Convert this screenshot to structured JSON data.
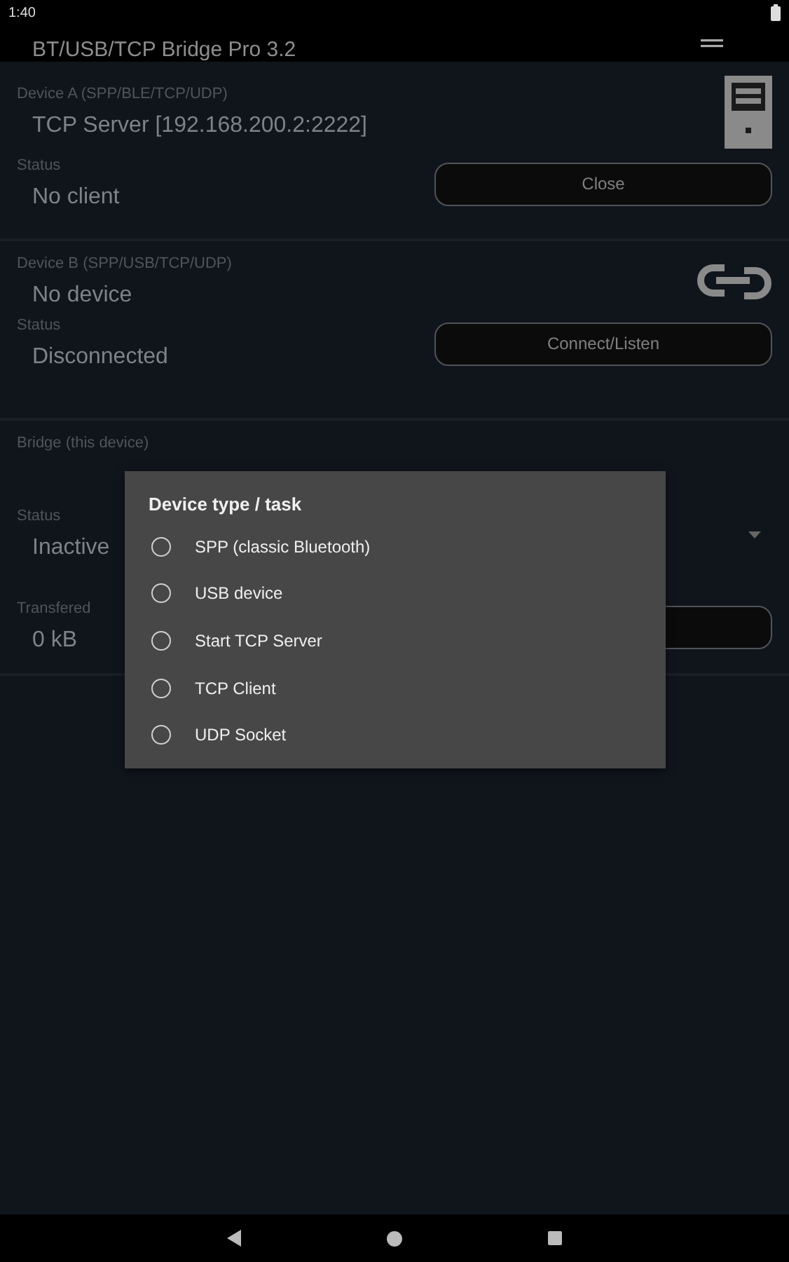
{
  "status_bar": {
    "time": "1:40"
  },
  "app_bar": {
    "title": "BT/USB/TCP Bridge Pro 3.2"
  },
  "sections": [
    {
      "kind": "device",
      "label": "Device A (SPP/BLE/TCP/UDP)",
      "value": "TCP Server [192.168.200.2:2222]",
      "status_label": "Status",
      "status": "No client",
      "button": "Close"
    },
    {
      "kind": "device",
      "label": "Device B (SPP/USB/TCP/UDP)",
      "value": "No device",
      "status_label": "Status",
      "status": "Disconnected",
      "button": "Connect/Listen"
    },
    {
      "kind": "bridge",
      "label": "Bridge (this device)",
      "status_label": "Status",
      "status": "Inactive",
      "transfer_label": "Transfered",
      "transfer": "0 kB"
    }
  ],
  "dialog": {
    "title": "Device type / task",
    "options": [
      {
        "label": "SPP (classic Bluetooth)",
        "selected": false
      },
      {
        "label": "USB device",
        "selected": false
      },
      {
        "label": "Start TCP Server",
        "selected": false
      },
      {
        "label": "TCP Client",
        "selected": false
      },
      {
        "label": "UDP Socket",
        "selected": false
      }
    ]
  }
}
